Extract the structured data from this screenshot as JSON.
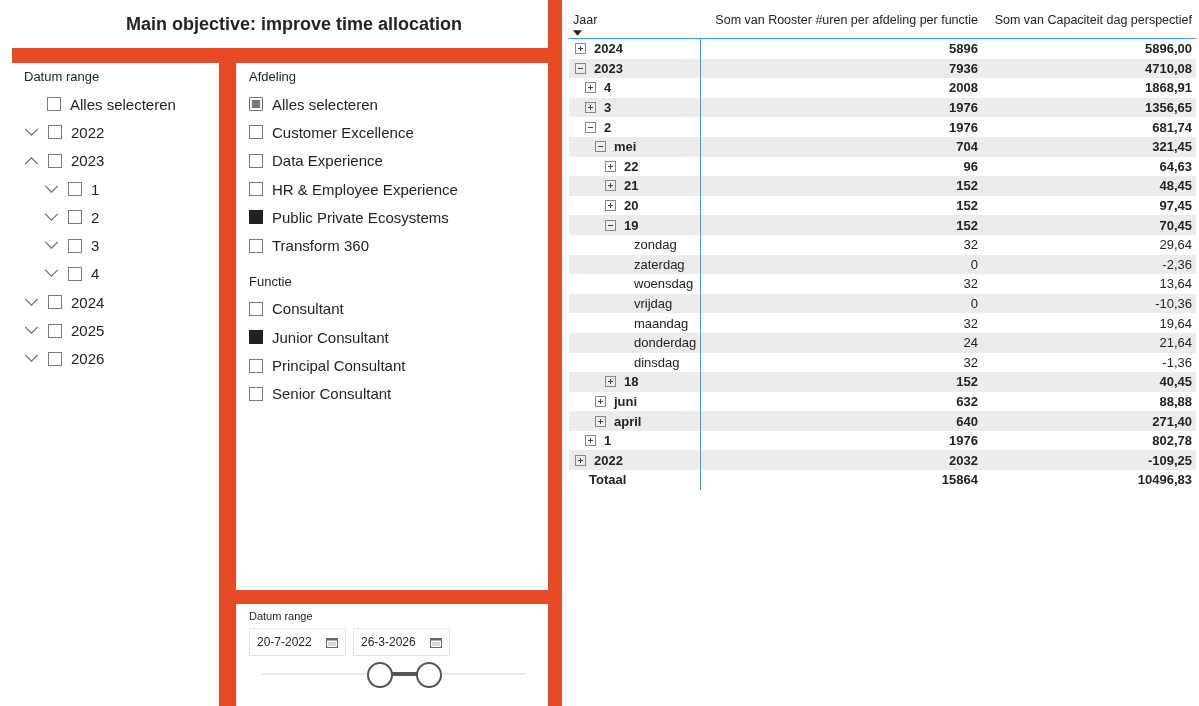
{
  "title": "Main objective: improve time allocation",
  "date_slicer": {
    "label": "Datum range",
    "select_all": {
      "label": "Alles selecteren",
      "checked": false
    },
    "items": [
      {
        "label": "2022",
        "checked": false,
        "expanded": false
      },
      {
        "label": "2023",
        "checked": false,
        "expanded": true,
        "children": [
          {
            "label": "1",
            "checked": false,
            "expanded": false
          },
          {
            "label": "2",
            "checked": false,
            "expanded": false
          },
          {
            "label": "3",
            "checked": false,
            "expanded": false
          },
          {
            "label": "4",
            "checked": false,
            "expanded": false
          }
        ]
      },
      {
        "label": "2024",
        "checked": false,
        "expanded": false
      },
      {
        "label": "2025",
        "checked": false,
        "expanded": false
      },
      {
        "label": "2026",
        "checked": false,
        "expanded": false
      }
    ]
  },
  "filters": [
    {
      "label": "Afdeling",
      "items": [
        {
          "label": "Alles selecteren",
          "checked": false,
          "partial": true
        },
        {
          "label": "Customer Excellence",
          "checked": false,
          "partial": false
        },
        {
          "label": "Data Experience",
          "checked": false,
          "partial": false
        },
        {
          "label": "HR & Employee Experience",
          "checked": false,
          "partial": false
        },
        {
          "label": "Public Private Ecosystems",
          "checked": true,
          "partial": false
        },
        {
          "label": "Transform 360",
          "checked": false,
          "partial": false
        }
      ]
    },
    {
      "label": "Functie",
      "items": [
        {
          "label": "Consultant",
          "checked": false,
          "partial": false
        },
        {
          "label": "Junior Consultant",
          "checked": true,
          "partial": false
        },
        {
          "label": "Principal Consultant",
          "checked": false,
          "partial": false
        },
        {
          "label": "Senior Consultant",
          "checked": false,
          "partial": false
        }
      ]
    }
  ],
  "date_range": {
    "label": "Datum range",
    "start": "20-7-2022",
    "end": "26-3-2026",
    "slider": {
      "start": {
        "level": 0.45
      },
      "end": {
        "level": 0.634
      }
    }
  },
  "table": {
    "columns": [
      "Jaar",
      "Som van Rooster #uren per afdeling per functie",
      "Som van Capaciteit dag perspectief"
    ],
    "rows": [
      {
        "kind": "group",
        "label": "2024",
        "values": [
          "5896",
          "5896,00"
        ],
        "expanded": false
      },
      {
        "kind": "group",
        "label": "2023",
        "values": [
          "7936",
          "4710,08"
        ],
        "expanded": true,
        "children": [
          {
            "kind": "group",
            "label": "4",
            "values": [
              "2008",
              "1868,91"
            ],
            "expanded": false
          },
          {
            "kind": "group",
            "label": "3",
            "values": [
              "1976",
              "1356,65"
            ],
            "expanded": false
          },
          {
            "kind": "group",
            "label": "2",
            "values": [
              "1976",
              "681,74"
            ],
            "expanded": true,
            "children": [
              {
                "kind": "group",
                "label": "mei",
                "values": [
                  "704",
                  "321,45"
                ],
                "expanded": true,
                "children": [
                  {
                    "kind": "group",
                    "label": "22",
                    "values": [
                      "96",
                      "64,63"
                    ],
                    "expanded": false
                  },
                  {
                    "kind": "group",
                    "label": "21",
                    "values": [
                      "152",
                      "48,45"
                    ],
                    "expanded": false
                  },
                  {
                    "kind": "group",
                    "label": "20",
                    "values": [
                      "152",
                      "97,45"
                    ],
                    "expanded": false
                  },
                  {
                    "kind": "group",
                    "label": "19",
                    "values": [
                      "152",
                      "70,45"
                    ],
                    "expanded": true,
                    "children": [
                      {
                        "kind": "leaf",
                        "label": "zondag",
                        "values": [
                          "32",
                          "29,64"
                        ]
                      },
                      {
                        "kind": "leaf",
                        "label": "zaterdag",
                        "values": [
                          "0",
                          "-2,36"
                        ]
                      },
                      {
                        "kind": "leaf",
                        "label": "woensdag",
                        "values": [
                          "32",
                          "13,64"
                        ]
                      },
                      {
                        "kind": "leaf",
                        "label": "vrijdag",
                        "values": [
                          "0",
                          "-10,36"
                        ]
                      },
                      {
                        "kind": "leaf",
                        "label": "maandag",
                        "values": [
                          "32",
                          "19,64"
                        ]
                      },
                      {
                        "kind": "leaf",
                        "label": "donderdag",
                        "values": [
                          "24",
                          "21,64"
                        ]
                      },
                      {
                        "kind": "leaf",
                        "label": "dinsdag",
                        "values": [
                          "32",
                          "-1,36"
                        ]
                      }
                    ]
                  },
                  {
                    "kind": "group",
                    "label": "18",
                    "values": [
                      "152",
                      "40,45"
                    ],
                    "expanded": false
                  }
                ]
              },
              {
                "kind": "group",
                "label": "juni",
                "values": [
                  "632",
                  "88,88"
                ],
                "expanded": false
              },
              {
                "kind": "group",
                "label": "april",
                "values": [
                  "640",
                  "271,40"
                ],
                "expanded": false
              }
            ]
          },
          {
            "kind": "group",
            "label": "1",
            "values": [
              "1976",
              "802,78"
            ],
            "expanded": false
          }
        ]
      },
      {
        "kind": "group",
        "label": "2022",
        "values": [
          "2032",
          "-109,25"
        ],
        "expanded": false
      }
    ],
    "total": {
      "label": "Totaal",
      "values": [
        "15864",
        "10496,83"
      ]
    }
  }
}
